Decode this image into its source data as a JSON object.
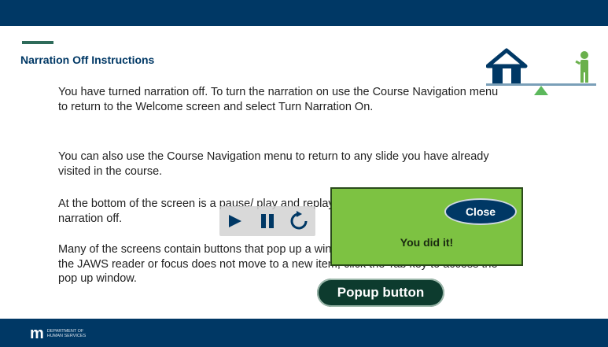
{
  "slide": {
    "title": "Narration Off Instructions",
    "paragraphs": [
      "You have turned narration off. To turn the narration on use the Course Navigation menu to return to the Welcome screen and select Turn Narration On.",
      "You can also use the Course Navigation menu to return to any slide you have already visited in the course.",
      "At the bottom of the screen is a pause/ play and replay button that will function with narration off.",
      "Many of the screens contain buttons that pop up a window. If you select a button and the JAWS reader or focus does not move to a new item, click the Tab key to access the pop up window."
    ]
  },
  "media": {
    "play_icon": "play-icon",
    "pause_icon": "pause-icon",
    "replay_icon": "replay-icon"
  },
  "popup": {
    "close_label": "Close",
    "message": "You did it!"
  },
  "popup_button": {
    "label": "Popup button"
  },
  "footer": {
    "logo_mark": "m",
    "logo_line1": "DEPARTMENT OF",
    "logo_line2": "HUMAN SERVICES"
  },
  "colors": {
    "brand_navy": "#003865",
    "popup_green": "#7dc242",
    "button_dark_green": "#0d3b2e"
  }
}
